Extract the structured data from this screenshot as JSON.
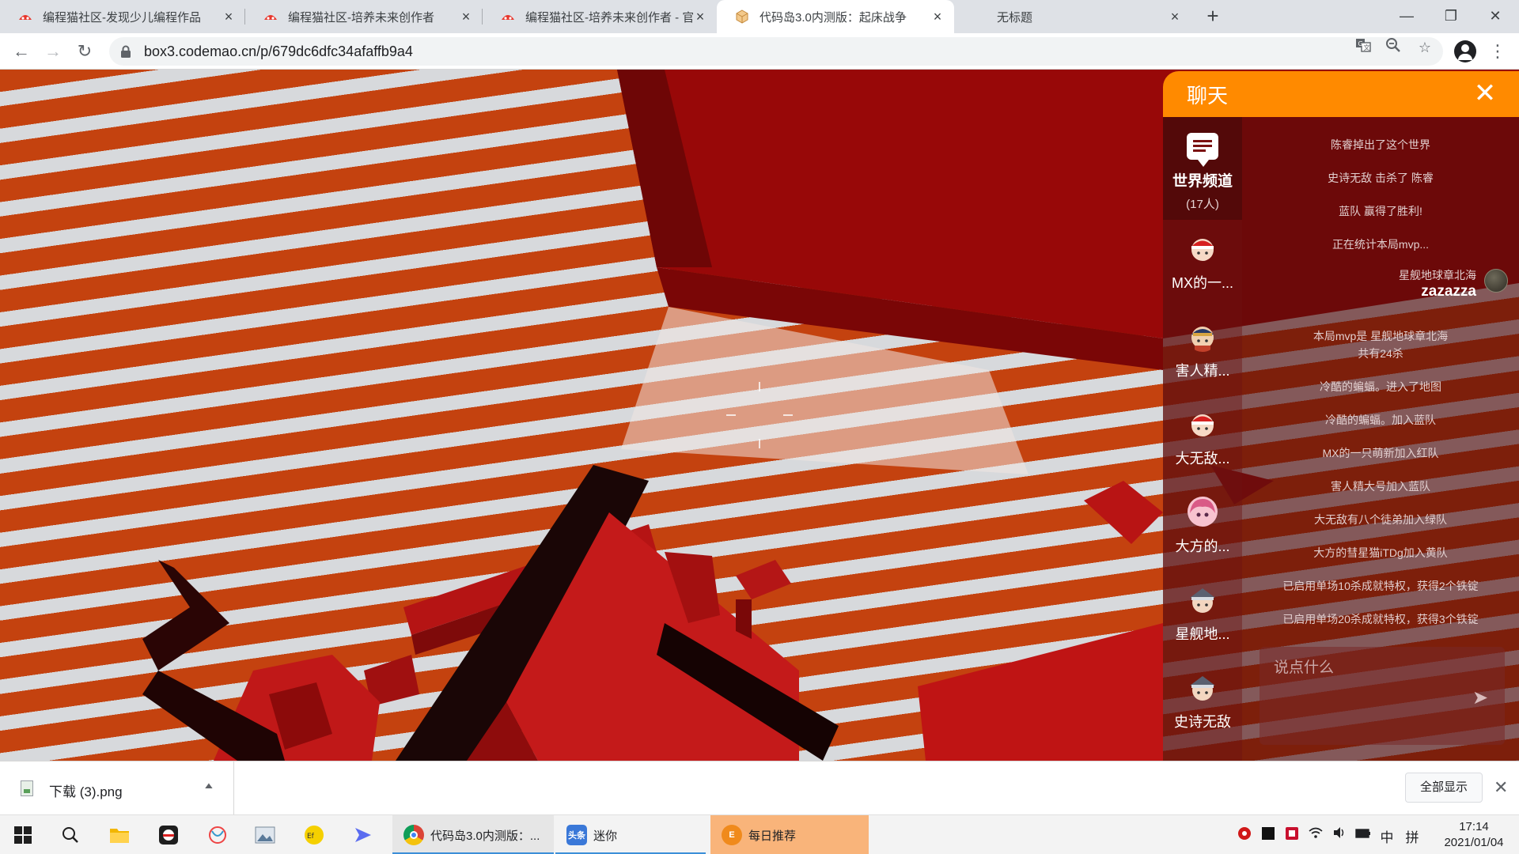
{
  "browser": {
    "tabs": [
      {
        "title": "编程猫社区-发现少儿编程作品",
        "favicon": "codemao-icon"
      },
      {
        "title": "编程猫社区-培养未来创作者",
        "favicon": "codemao-icon"
      },
      {
        "title": "编程猫社区-培养未来创作者 - 官",
        "favicon": "codemao-icon"
      },
      {
        "title": "代码岛3.0内测版：起床战争",
        "favicon": "box3-icon"
      },
      {
        "title": "无标题",
        "favicon": ""
      }
    ],
    "url": "box3.codemao.cn/p/679dc6dfc34afaffb9a4"
  },
  "chat": {
    "title": "聊天",
    "world_channel": {
      "label": "世界频道",
      "count": "(17人)"
    },
    "players": [
      {
        "name": "MX的一..."
      },
      {
        "name": "害人精..."
      },
      {
        "name": "大无敌..."
      },
      {
        "name": "大方的..."
      },
      {
        "name": "星舰地..."
      },
      {
        "name": "史诗无敌"
      }
    ],
    "messages": {
      "m1": "陈睿掉出了这个世界",
      "m2": "史诗无敌 击杀了 陈睿",
      "m3": "蓝队 赢得了胜利!",
      "m4": "正在统计本局mvp...",
      "user_name": "星舰地球章北海",
      "user_text": "zazazza",
      "m6a": "本局mvp是 星舰地球章北海",
      "m6b": "共有24杀",
      "m7": "冷酷的蝙蝠。进入了地图",
      "m8": "冷酷的蝙蝠。加入蓝队",
      "m9": "MX的一只萌新加入红队",
      "m10": "害人精大号加入蓝队",
      "m11": "大无敌有八个徒弟加入绿队",
      "m12": "大方的彗星猫iTDg加入黄队",
      "m13": "已启用单场10杀成就特权，获得2个铁锭",
      "m14": "已启用单场20杀成就特权，获得3个铁锭"
    },
    "input_placeholder": "说点什么"
  },
  "downloads": {
    "file_name": "下载 (3).png",
    "show_all": "全部显示"
  },
  "taskbar": {
    "apps": [
      {
        "label": "代码岛3.0内测版：..."
      },
      {
        "label": "迷你"
      },
      {
        "label": "每日推荐"
      }
    ],
    "ime": "中",
    "ime2": "拼",
    "time": "17:14",
    "date": "2021/01/04"
  },
  "colors": {
    "chat_header": "#ff8a00",
    "game_orange": "#c4420f",
    "game_red": "#b01010"
  }
}
